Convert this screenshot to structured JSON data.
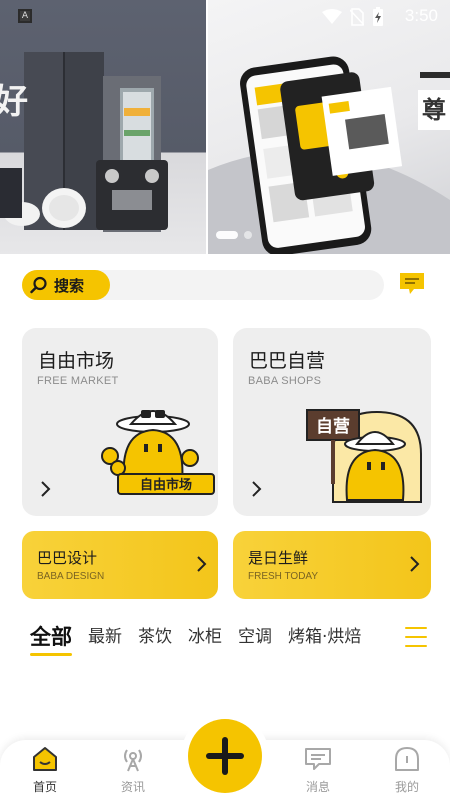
{
  "status_bar": {
    "time": "3:50"
  },
  "banner": {
    "left_slide_char": "好",
    "right_slide_char": "尊",
    "slide_count": 2,
    "active_slide": 1
  },
  "search": {
    "label": "搜索",
    "icon": "search-icon"
  },
  "header_actions": {
    "message_icon": "message-icon"
  },
  "cards": {
    "free_market": {
      "title": "自由市场",
      "subtitle": "FREE MARKET",
      "sign_text": "自由市场"
    },
    "baba_shops": {
      "title": "巴巴自营",
      "subtitle": "BABA SHOPS",
      "sign_text": "自营"
    },
    "baba_design": {
      "title": "巴巴设计",
      "subtitle": "BABA DESIGN"
    },
    "fresh_today": {
      "title": "是日生鲜",
      "subtitle": "FRESH TODAY"
    }
  },
  "category_tabs": [
    "全部",
    "最新",
    "茶饮",
    "冰柜",
    "空调",
    "烤箱·烘焙"
  ],
  "active_tab": 0,
  "bottom_nav": [
    {
      "label": "首页",
      "icon": "home-icon",
      "active": true
    },
    {
      "label": "资讯",
      "icon": "broadcast-icon",
      "active": false
    },
    {
      "label": "消息",
      "icon": "message-icon",
      "active": false
    },
    {
      "label": "我的",
      "icon": "profile-icon",
      "active": false
    }
  ],
  "colors": {
    "accent": "#f5c400",
    "card_bg": "#eeeeee",
    "text": "#1a1a1a",
    "muted": "#8c8c8c"
  }
}
